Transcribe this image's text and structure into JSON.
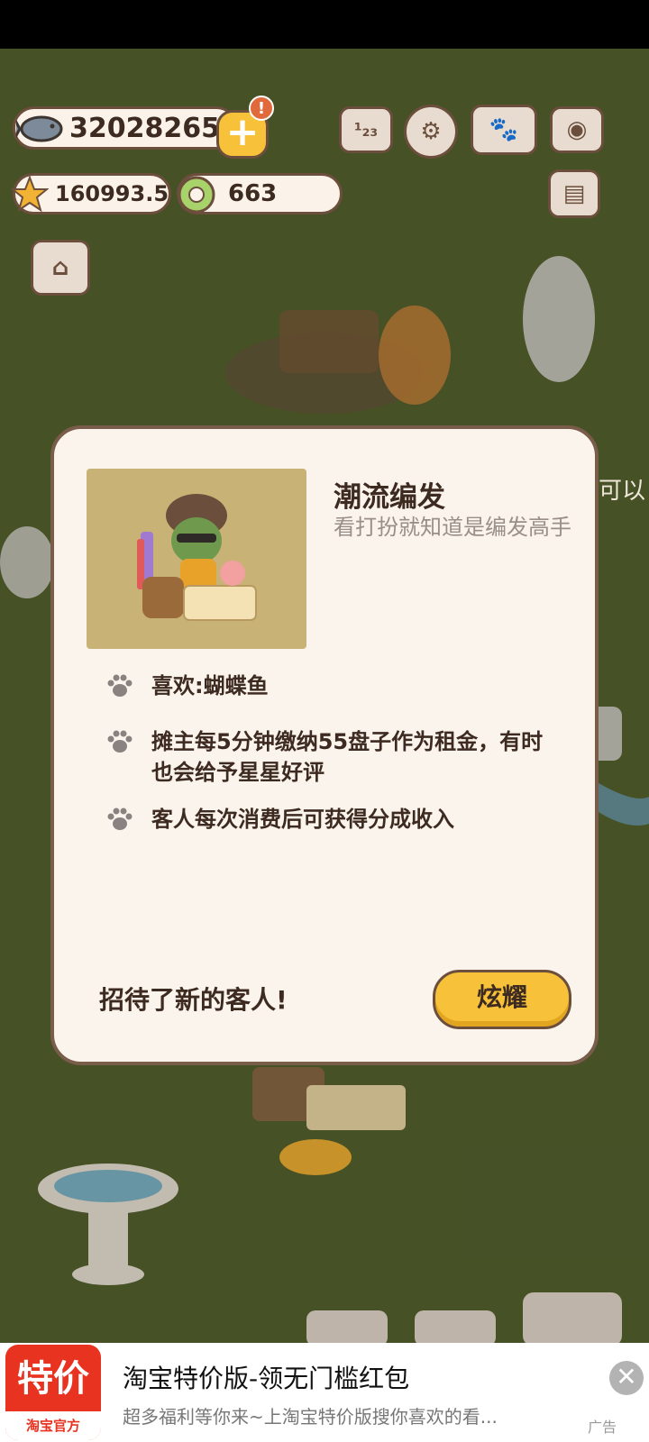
{
  "hud": {
    "fish_count": "32028265",
    "star_rating": "160993.5",
    "gem_count": "663",
    "add_label": "+",
    "alert_mark": "!",
    "rank_label": "¹₂₃"
  },
  "scene_text": {
    "partial_sign": "可以"
  },
  "dialog": {
    "title": "潮流编发",
    "subtitle": "看打扮就知道是编发高手",
    "features": [
      "喜欢:蝴蝶鱼",
      "摊主每5分钟缴纳55盘子作为租金，有时也会给予星星好评",
      "客人每次消费后可获得分成收入"
    ],
    "footer": "招待了新的客人!",
    "button": "炫耀"
  },
  "ad": {
    "logo_big": "特价",
    "logo_small": "淘宝官方",
    "title": "淘宝特价版-领无门槛红包",
    "description": "超多福利等你来~上淘宝特价版搜你喜欢的看...",
    "close": "✕",
    "label": "广告"
  },
  "colors": {
    "accent_yellow": "#f7c23a",
    "border_brown": "#6b4e3c",
    "panel_cream": "#fbf4ec",
    "ad_red": "#e83320"
  },
  "icons": [
    "fish-icon",
    "plus-icon",
    "star-icon",
    "gem-icon",
    "ranking-icon",
    "settings-icon",
    "catalog-book-icon",
    "camera-icon",
    "shop-icon",
    "news-icon",
    "paw-icon",
    "close-icon"
  ]
}
